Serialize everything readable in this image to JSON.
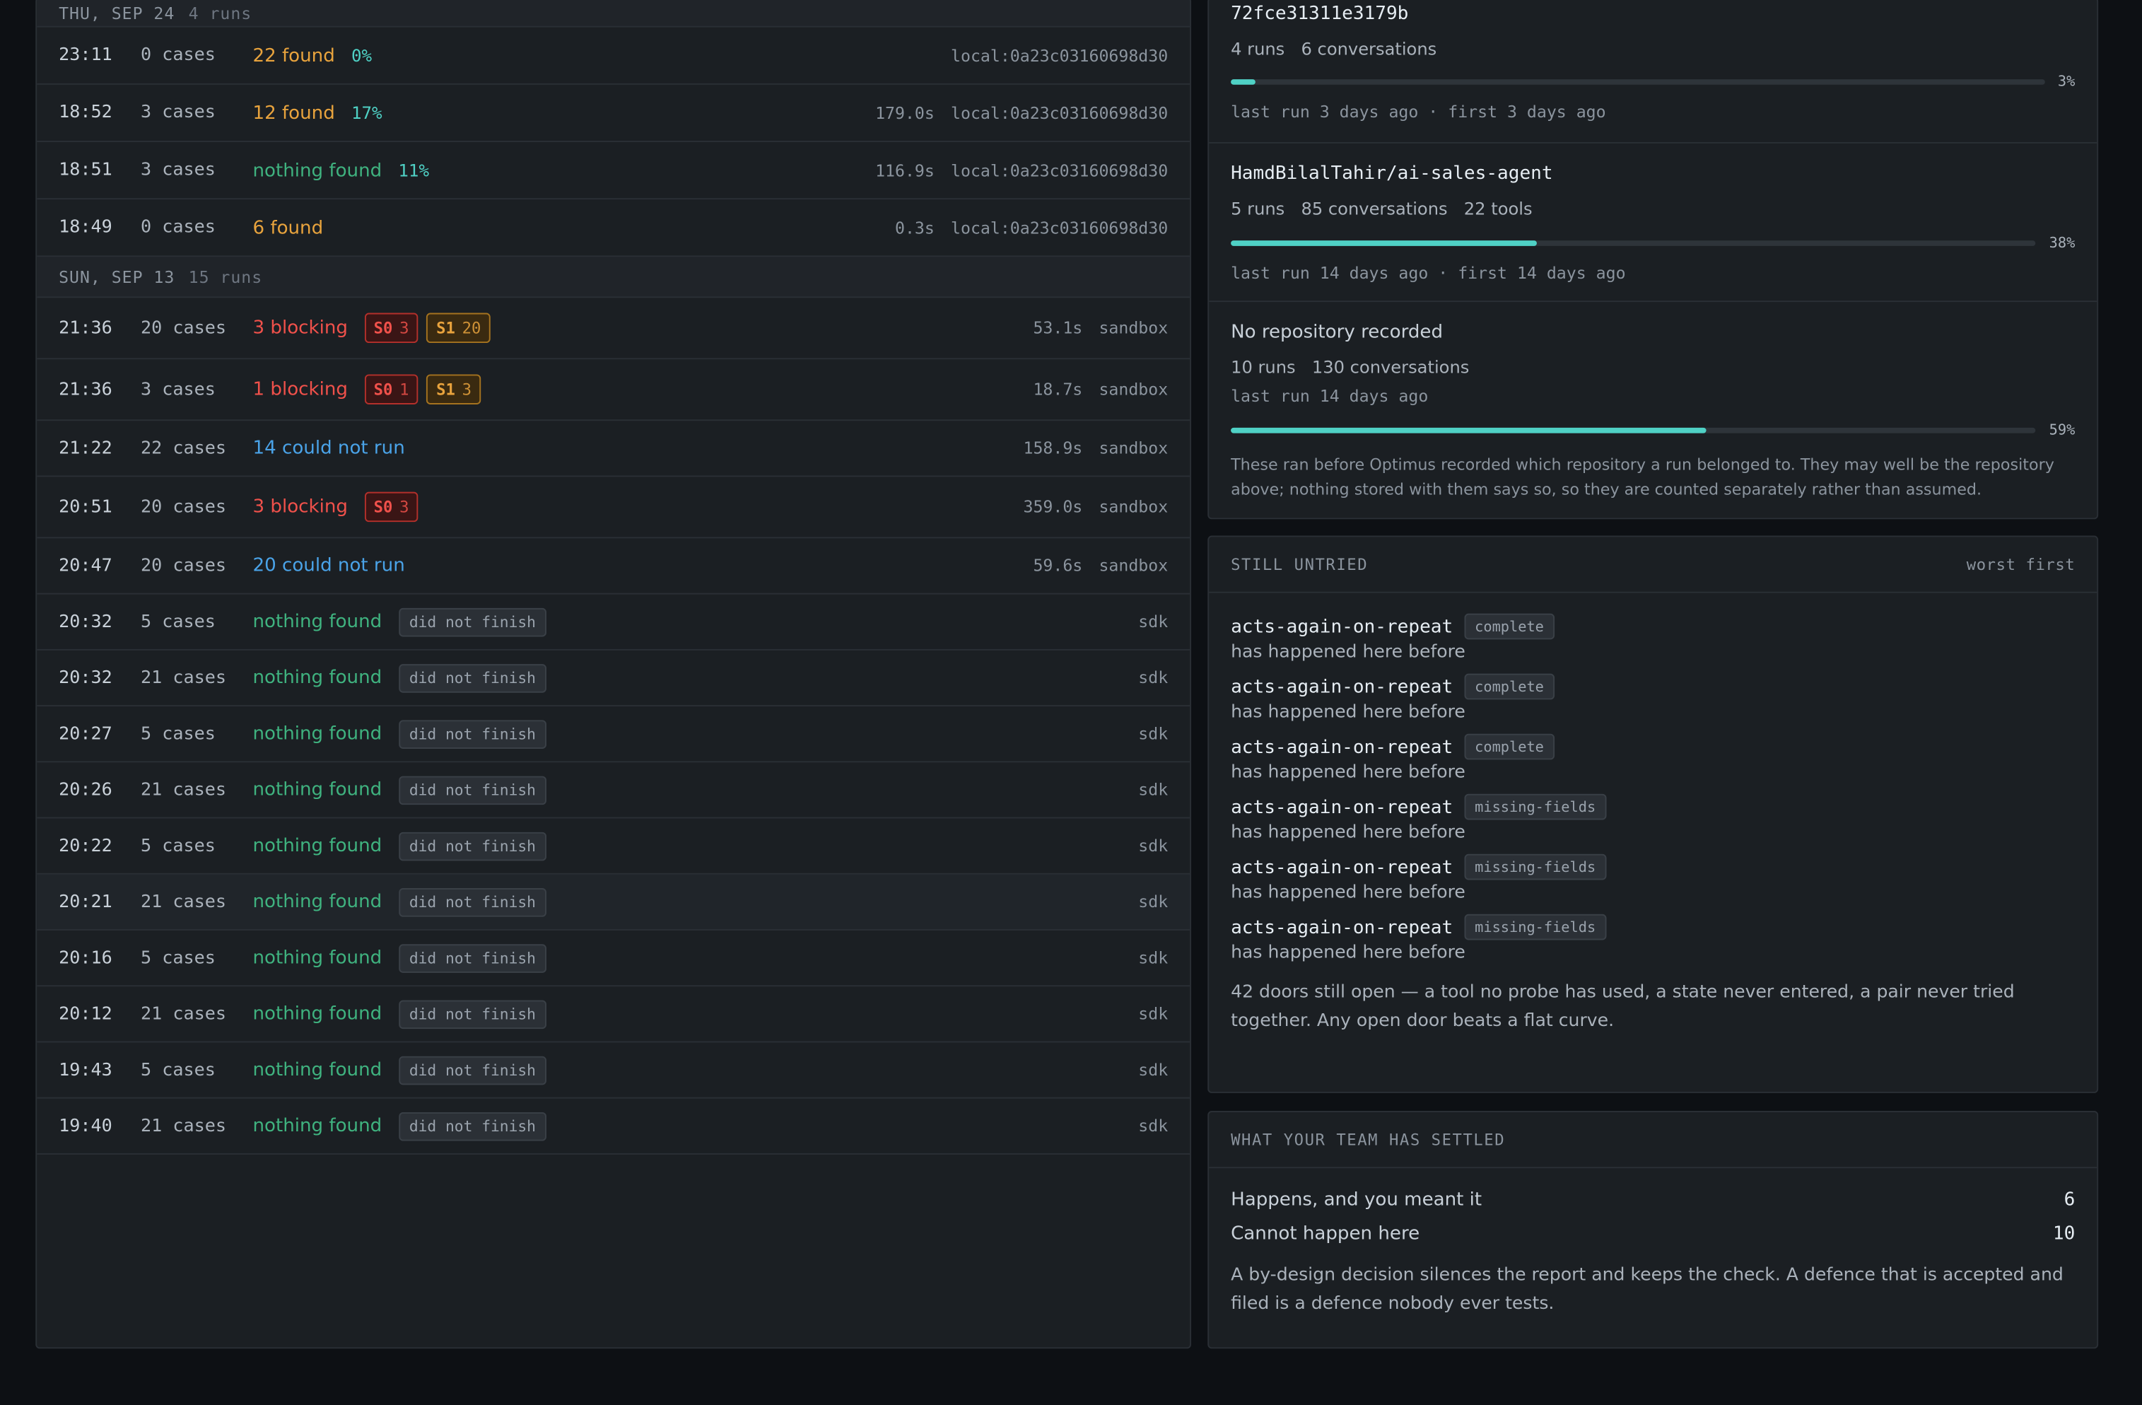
{
  "runs_panel": {
    "groups": [
      {
        "day": "THU, SEP 24",
        "count": "4 runs",
        "rows": [
          {
            "time": "23:11",
            "cases": "0 cases",
            "result": "22 found",
            "result_color": "orange",
            "pct": "0%",
            "duration": "",
            "target": "local:0a23c03160698d30",
            "badges": [],
            "tag": ""
          },
          {
            "time": "18:52",
            "cases": "3 cases",
            "result": "12 found",
            "result_color": "orange",
            "pct": "17%",
            "duration": "179.0s",
            "target": "local:0a23c03160698d30",
            "badges": [],
            "tag": ""
          },
          {
            "time": "18:51",
            "cases": "3 cases",
            "result": "nothing found",
            "result_color": "green",
            "pct": "11%",
            "duration": "116.9s",
            "target": "local:0a23c03160698d30",
            "badges": [],
            "tag": ""
          },
          {
            "time": "18:49",
            "cases": "0 cases",
            "result": "6 found",
            "result_color": "orange",
            "pct": "",
            "duration": "0.3s",
            "target": "local:0a23c03160698d30",
            "badges": [],
            "tag": ""
          }
        ]
      },
      {
        "day": "SUN, SEP 13",
        "count": "15 runs",
        "rows": [
          {
            "time": "21:36",
            "cases": "20 cases",
            "result": "3 blocking",
            "result_color": "red",
            "pct": "",
            "duration": "53.1s",
            "target": "sandbox",
            "badges": [
              {
                "sev": "S0",
                "n": "3"
              },
              {
                "sev": "S1",
                "n": "20"
              }
            ],
            "tag": ""
          },
          {
            "time": "21:36",
            "cases": "3 cases",
            "result": "1 blocking",
            "result_color": "red",
            "pct": "",
            "duration": "18.7s",
            "target": "sandbox",
            "badges": [
              {
                "sev": "S0",
                "n": "1"
              },
              {
                "sev": "S1",
                "n": "3"
              }
            ],
            "tag": ""
          },
          {
            "time": "21:22",
            "cases": "22 cases",
            "result": "14 could not run",
            "result_color": "blue",
            "pct": "",
            "duration": "158.9s",
            "target": "sandbox",
            "badges": [],
            "tag": ""
          },
          {
            "time": "20:51",
            "cases": "20 cases",
            "result": "3 blocking",
            "result_color": "red",
            "pct": "",
            "duration": "359.0s",
            "target": "sandbox",
            "badges": [
              {
                "sev": "S0",
                "n": "3"
              }
            ],
            "tag": ""
          },
          {
            "time": "20:47",
            "cases": "20 cases",
            "result": "20 could not run",
            "result_color": "blue",
            "pct": "",
            "duration": "59.6s",
            "target": "sandbox",
            "badges": [],
            "tag": ""
          },
          {
            "time": "20:32",
            "cases": "5 cases",
            "result": "nothing found",
            "result_color": "green",
            "pct": "",
            "duration": "",
            "target": "sdk",
            "badges": [],
            "tag": "did not finish"
          },
          {
            "time": "20:32",
            "cases": "21 cases",
            "result": "nothing found",
            "result_color": "green",
            "pct": "",
            "duration": "",
            "target": "sdk",
            "badges": [],
            "tag": "did not finish"
          },
          {
            "time": "20:27",
            "cases": "5 cases",
            "result": "nothing found",
            "result_color": "green",
            "pct": "",
            "duration": "",
            "target": "sdk",
            "badges": [],
            "tag": "did not finish"
          },
          {
            "time": "20:26",
            "cases": "21 cases",
            "result": "nothing found",
            "result_color": "green",
            "pct": "",
            "duration": "",
            "target": "sdk",
            "badges": [],
            "tag": "did not finish"
          },
          {
            "time": "20:22",
            "cases": "5 cases",
            "result": "nothing found",
            "result_color": "green",
            "pct": "",
            "duration": "",
            "target": "sdk",
            "badges": [],
            "tag": "did not finish"
          },
          {
            "time": "20:21",
            "cases": "21 cases",
            "result": "nothing found",
            "result_color": "green",
            "pct": "",
            "duration": "",
            "target": "sdk",
            "badges": [],
            "tag": "did not finish"
          },
          {
            "time": "20:16",
            "cases": "5 cases",
            "result": "nothing found",
            "result_color": "green",
            "pct": "",
            "duration": "",
            "target": "sdk",
            "badges": [],
            "tag": "did not finish"
          },
          {
            "time": "20:12",
            "cases": "21 cases",
            "result": "nothing found",
            "result_color": "green",
            "pct": "",
            "duration": "",
            "target": "sdk",
            "badges": [],
            "tag": "did not finish"
          },
          {
            "time": "19:43",
            "cases": "5 cases",
            "result": "nothing found",
            "result_color": "green",
            "pct": "",
            "duration": "",
            "target": "sdk",
            "badges": [],
            "tag": "did not finish"
          },
          {
            "time": "19:40",
            "cases": "21 cases",
            "result": "nothing found",
            "result_color": "green",
            "pct": "",
            "duration": "",
            "target": "sdk",
            "badges": [],
            "tag": "did not finish"
          }
        ]
      }
    ]
  },
  "repos": [
    {
      "name": "72fce31311e3179b",
      "stats": [
        "4 runs",
        "6 conversations"
      ],
      "coverage_pct": 3,
      "coverage_label": "3%",
      "meta": "last run 3 days ago · first 3 days ago"
    },
    {
      "name": "HamdBilalTahir/ai-sales-agent",
      "stats": [
        "5 runs",
        "85 conversations",
        "22 tools"
      ],
      "coverage_pct": 38,
      "coverage_label": "38%",
      "meta": "last run 14 days ago · first 14 days ago"
    },
    {
      "name": "No repository recorded",
      "stats": [
        "10 runs",
        "130 conversations"
      ],
      "coverage_pct": 59,
      "coverage_label": "59%",
      "meta": "last run 14 days ago",
      "note": "These ran before Optimus recorded which repository a run belonged to. They may well be the repository above; nothing stored with them says so, so they are counted separately rather than assumed."
    }
  ],
  "untried": {
    "title": "STILL UNTRIED",
    "sort_label": "worst first",
    "items": [
      {
        "name": "acts-again-on-repeat",
        "tag": "complete",
        "desc": "has happened here before"
      },
      {
        "name": "acts-again-on-repeat",
        "tag": "complete",
        "desc": "has happened here before"
      },
      {
        "name": "acts-again-on-repeat",
        "tag": "complete",
        "desc": "has happened here before"
      },
      {
        "name": "acts-again-on-repeat",
        "tag": "missing-fields",
        "desc": "has happened here before"
      },
      {
        "name": "acts-again-on-repeat",
        "tag": "missing-fields",
        "desc": "has happened here before"
      },
      {
        "name": "acts-again-on-repeat",
        "tag": "missing-fields",
        "desc": "has happened here before"
      }
    ],
    "footer": "42 doors still open — a tool no probe has used, a state never entered, a pair never tried together. Any open door beats a flat curve."
  },
  "settled": {
    "title": "WHAT YOUR TEAM HAS SETTLED",
    "rows": [
      {
        "label": "Happens, and you meant it",
        "value": "6"
      },
      {
        "label": "Cannot happen here",
        "value": "10"
      }
    ],
    "footer": "A by-design decision silences the report and keeps the check. A defence that is accepted and filed is a defence nobody ever tests."
  }
}
